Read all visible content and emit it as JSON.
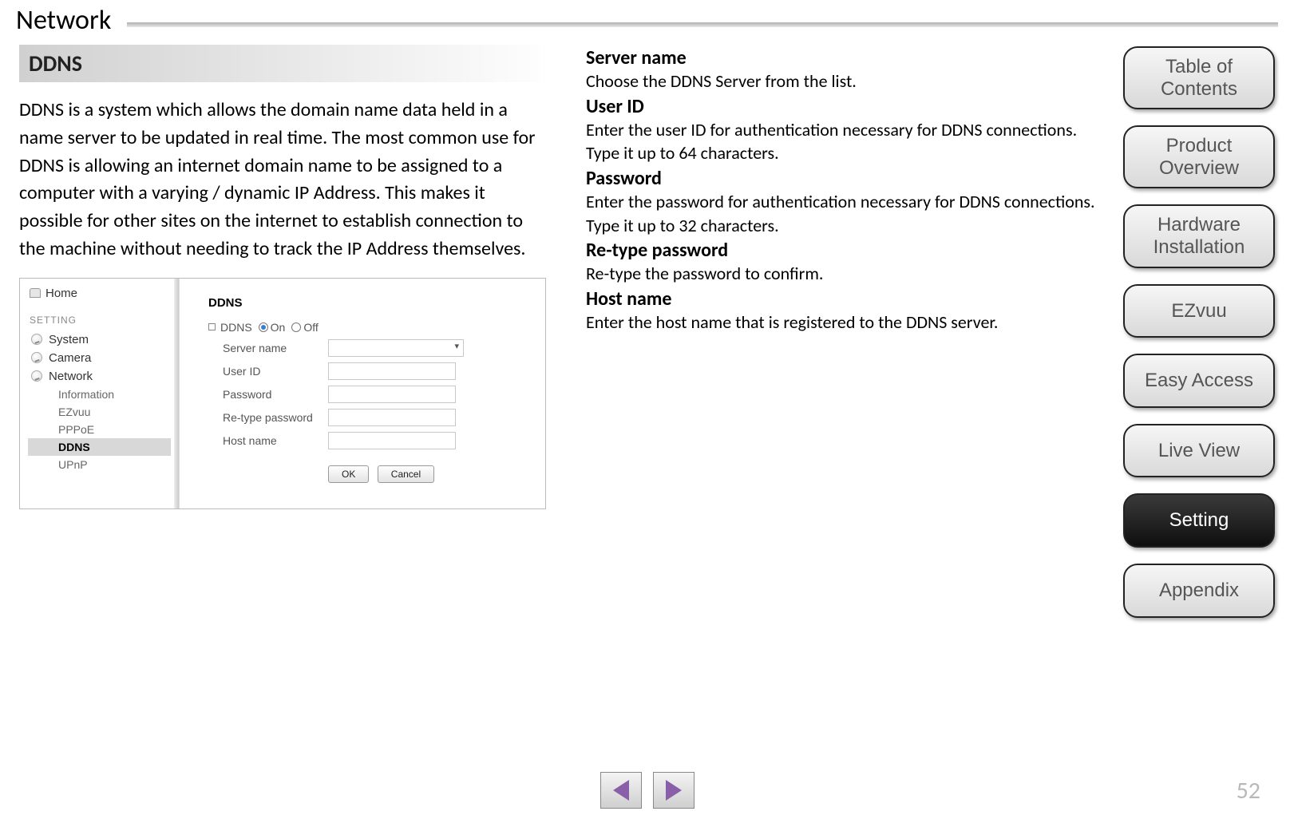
{
  "page": {
    "title": "Network",
    "number": "52"
  },
  "section": {
    "heading": "DDNS",
    "intro": "DDNS is a system which allows the domain name data held in a name server to be updated in real time. The most common use for DDNS is allowing an internet domain name to be assigned to a computer with a varying / dynamic IP Address. This makes it possible for other sites on the internet to establish connection to the machine without needing to track the IP Address themselves."
  },
  "defs": {
    "server_name_h": "Server name",
    "server_name_b": "Choose the DDNS Server from the list.",
    "user_id_h": "User ID",
    "user_id_b": "Enter the user ID for authentication necessary for DDNS connections. Type it up to 64 characters.",
    "password_h": "Password",
    "password_b": "Enter the password for authentication necessary for DDNS connections. Type it up to 32 characters.",
    "retype_h": "Re-type password",
    "retype_b": "Re-type the password to confirm.",
    "hostname_h": "Host name",
    "hostname_b": "Enter the host name that is registered to the DDNS server."
  },
  "embed": {
    "home": "Home",
    "setting": "SETTING",
    "system": "System",
    "camera": "Camera",
    "network": "Network",
    "sub_information": "Information",
    "sub_ezvuu": "EZvuu",
    "sub_pppoe": "PPPoE",
    "sub_ddns": "DDNS",
    "sub_upnp": "UPnP",
    "panel_title": "DDNS",
    "ddns_label": "DDNS",
    "on": "On",
    "off": "Off",
    "server_name": "Server name",
    "user_id": "User ID",
    "password": "Password",
    "retype": "Re-type password",
    "hostname": "Host name",
    "ok": "OK",
    "cancel": "Cancel"
  },
  "nav": {
    "toc": "Table of Contents",
    "product": "Product Overview",
    "hardware": "Hardware Installation",
    "ezvuu": "EZvuu",
    "easy": "Easy Access",
    "live": "Live View",
    "setting": "Setting",
    "appendix": "Appendix"
  }
}
